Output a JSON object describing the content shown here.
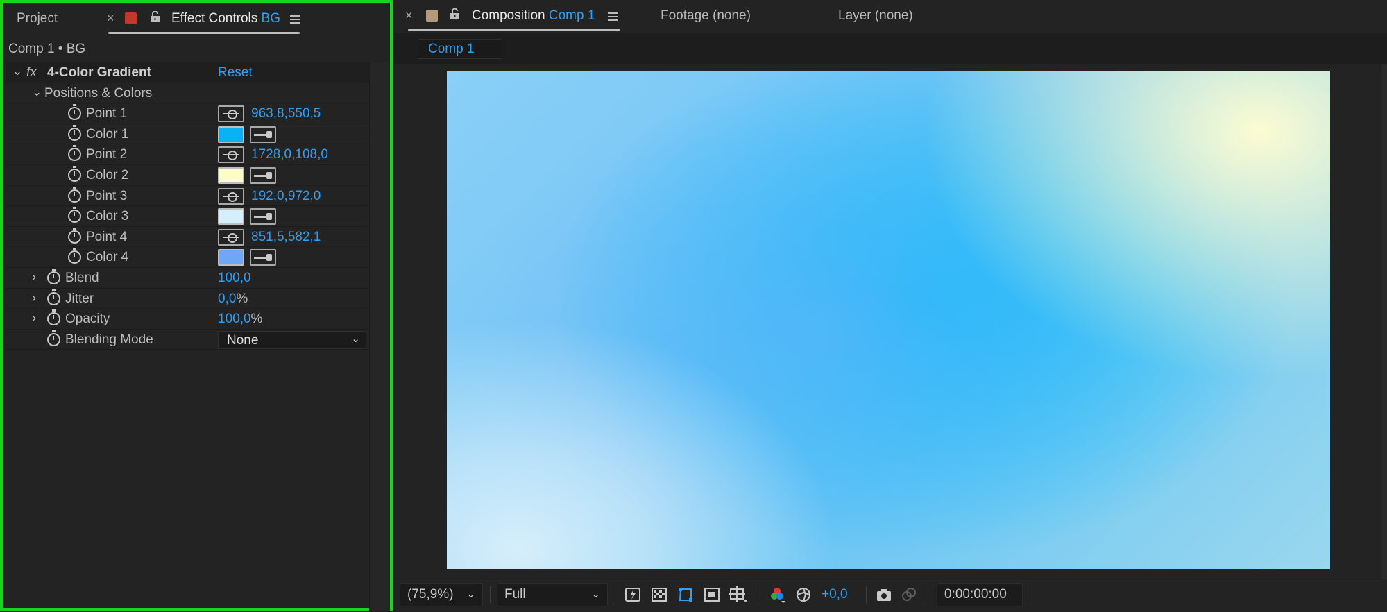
{
  "left_panel": {
    "tabs": {
      "project": "Project",
      "close": "×",
      "effect_controls_label": "Effect Controls",
      "effect_controls_layer": "BG"
    },
    "comp_path": "Comp 1 • BG",
    "effect": {
      "fx": "fx",
      "name": "4-Color Gradient",
      "reset": "Reset",
      "group": "Positions & Colors",
      "point1": {
        "label": "Point 1",
        "value": "963,8,550,5"
      },
      "color1": {
        "label": "Color 1",
        "color": "#0ab2f5"
      },
      "point2": {
        "label": "Point 2",
        "value": "1728,0,108,0"
      },
      "color2": {
        "label": "Color 2",
        "color": "#fdfcc8"
      },
      "point3": {
        "label": "Point 3",
        "value": "192,0,972,0"
      },
      "color3": {
        "label": "Color 3",
        "color": "#d4eefb"
      },
      "point4": {
        "label": "Point 4",
        "value": "851,5,582,1"
      },
      "color4": {
        "label": "Color 4",
        "color": "#6ea8f5"
      },
      "blend": {
        "label": "Blend",
        "value": "100,0"
      },
      "jitter": {
        "label": "Jitter",
        "value": "0,0",
        "unit": "%"
      },
      "opacity": {
        "label": "Opacity",
        "value": "100,0",
        "unit": "%"
      },
      "blending_mode": {
        "label": "Blending Mode",
        "value": "None"
      }
    }
  },
  "right_panel": {
    "tabs": {
      "close": "×",
      "composition_label": "Composition",
      "composition_name": "Comp 1",
      "footage": "Footage (none)",
      "layer": "Layer (none)"
    },
    "subtab": "Comp 1",
    "bottom_bar": {
      "zoom": "(75,9%)",
      "resolution": "Full",
      "exposure": "+0,0",
      "timecode": "0:00:00:00"
    }
  },
  "colors": {
    "accent": "#2d9ff5",
    "highlight_border": "#13d81a",
    "label_color_swatch": "#c0392b",
    "comp_swatch": "#b29a7a"
  }
}
